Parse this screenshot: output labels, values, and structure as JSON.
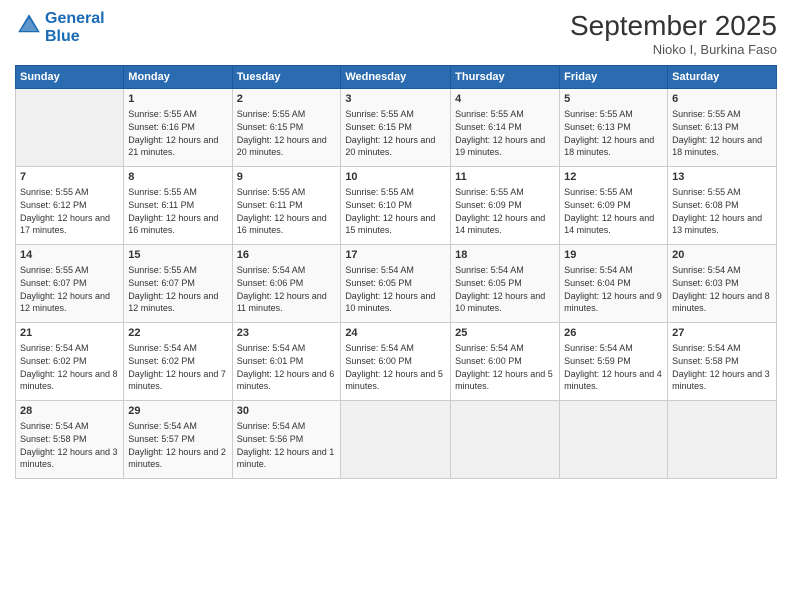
{
  "logo": {
    "line1": "General",
    "line2": "Blue"
  },
  "title": "September 2025",
  "subtitle": "Nioko I, Burkina Faso",
  "header_days": [
    "Sunday",
    "Monday",
    "Tuesday",
    "Wednesday",
    "Thursday",
    "Friday",
    "Saturday"
  ],
  "weeks": [
    [
      {
        "day": "",
        "sunrise": "",
        "sunset": "",
        "daylight": ""
      },
      {
        "day": "1",
        "sunrise": "Sunrise: 5:55 AM",
        "sunset": "Sunset: 6:16 PM",
        "daylight": "Daylight: 12 hours and 21 minutes."
      },
      {
        "day": "2",
        "sunrise": "Sunrise: 5:55 AM",
        "sunset": "Sunset: 6:15 PM",
        "daylight": "Daylight: 12 hours and 20 minutes."
      },
      {
        "day": "3",
        "sunrise": "Sunrise: 5:55 AM",
        "sunset": "Sunset: 6:15 PM",
        "daylight": "Daylight: 12 hours and 20 minutes."
      },
      {
        "day": "4",
        "sunrise": "Sunrise: 5:55 AM",
        "sunset": "Sunset: 6:14 PM",
        "daylight": "Daylight: 12 hours and 19 minutes."
      },
      {
        "day": "5",
        "sunrise": "Sunrise: 5:55 AM",
        "sunset": "Sunset: 6:13 PM",
        "daylight": "Daylight: 12 hours and 18 minutes."
      },
      {
        "day": "6",
        "sunrise": "Sunrise: 5:55 AM",
        "sunset": "Sunset: 6:13 PM",
        "daylight": "Daylight: 12 hours and 18 minutes."
      }
    ],
    [
      {
        "day": "7",
        "sunrise": "Sunrise: 5:55 AM",
        "sunset": "Sunset: 6:12 PM",
        "daylight": "Daylight: 12 hours and 17 minutes."
      },
      {
        "day": "8",
        "sunrise": "Sunrise: 5:55 AM",
        "sunset": "Sunset: 6:11 PM",
        "daylight": "Daylight: 12 hours and 16 minutes."
      },
      {
        "day": "9",
        "sunrise": "Sunrise: 5:55 AM",
        "sunset": "Sunset: 6:11 PM",
        "daylight": "Daylight: 12 hours and 16 minutes."
      },
      {
        "day": "10",
        "sunrise": "Sunrise: 5:55 AM",
        "sunset": "Sunset: 6:10 PM",
        "daylight": "Daylight: 12 hours and 15 minutes."
      },
      {
        "day": "11",
        "sunrise": "Sunrise: 5:55 AM",
        "sunset": "Sunset: 6:09 PM",
        "daylight": "Daylight: 12 hours and 14 minutes."
      },
      {
        "day": "12",
        "sunrise": "Sunrise: 5:55 AM",
        "sunset": "Sunset: 6:09 PM",
        "daylight": "Daylight: 12 hours and 14 minutes."
      },
      {
        "day": "13",
        "sunrise": "Sunrise: 5:55 AM",
        "sunset": "Sunset: 6:08 PM",
        "daylight": "Daylight: 12 hours and 13 minutes."
      }
    ],
    [
      {
        "day": "14",
        "sunrise": "Sunrise: 5:55 AM",
        "sunset": "Sunset: 6:07 PM",
        "daylight": "Daylight: 12 hours and 12 minutes."
      },
      {
        "day": "15",
        "sunrise": "Sunrise: 5:55 AM",
        "sunset": "Sunset: 6:07 PM",
        "daylight": "Daylight: 12 hours and 12 minutes."
      },
      {
        "day": "16",
        "sunrise": "Sunrise: 5:54 AM",
        "sunset": "Sunset: 6:06 PM",
        "daylight": "Daylight: 12 hours and 11 minutes."
      },
      {
        "day": "17",
        "sunrise": "Sunrise: 5:54 AM",
        "sunset": "Sunset: 6:05 PM",
        "daylight": "Daylight: 12 hours and 10 minutes."
      },
      {
        "day": "18",
        "sunrise": "Sunrise: 5:54 AM",
        "sunset": "Sunset: 6:05 PM",
        "daylight": "Daylight: 12 hours and 10 minutes."
      },
      {
        "day": "19",
        "sunrise": "Sunrise: 5:54 AM",
        "sunset": "Sunset: 6:04 PM",
        "daylight": "Daylight: 12 hours and 9 minutes."
      },
      {
        "day": "20",
        "sunrise": "Sunrise: 5:54 AM",
        "sunset": "Sunset: 6:03 PM",
        "daylight": "Daylight: 12 hours and 8 minutes."
      }
    ],
    [
      {
        "day": "21",
        "sunrise": "Sunrise: 5:54 AM",
        "sunset": "Sunset: 6:02 PM",
        "daylight": "Daylight: 12 hours and 8 minutes."
      },
      {
        "day": "22",
        "sunrise": "Sunrise: 5:54 AM",
        "sunset": "Sunset: 6:02 PM",
        "daylight": "Daylight: 12 hours and 7 minutes."
      },
      {
        "day": "23",
        "sunrise": "Sunrise: 5:54 AM",
        "sunset": "Sunset: 6:01 PM",
        "daylight": "Daylight: 12 hours and 6 minutes."
      },
      {
        "day": "24",
        "sunrise": "Sunrise: 5:54 AM",
        "sunset": "Sunset: 6:00 PM",
        "daylight": "Daylight: 12 hours and 5 minutes."
      },
      {
        "day": "25",
        "sunrise": "Sunrise: 5:54 AM",
        "sunset": "Sunset: 6:00 PM",
        "daylight": "Daylight: 12 hours and 5 minutes."
      },
      {
        "day": "26",
        "sunrise": "Sunrise: 5:54 AM",
        "sunset": "Sunset: 5:59 PM",
        "daylight": "Daylight: 12 hours and 4 minutes."
      },
      {
        "day": "27",
        "sunrise": "Sunrise: 5:54 AM",
        "sunset": "Sunset: 5:58 PM",
        "daylight": "Daylight: 12 hours and 3 minutes."
      }
    ],
    [
      {
        "day": "28",
        "sunrise": "Sunrise: 5:54 AM",
        "sunset": "Sunset: 5:58 PM",
        "daylight": "Daylight: 12 hours and 3 minutes."
      },
      {
        "day": "29",
        "sunrise": "Sunrise: 5:54 AM",
        "sunset": "Sunset: 5:57 PM",
        "daylight": "Daylight: 12 hours and 2 minutes."
      },
      {
        "day": "30",
        "sunrise": "Sunrise: 5:54 AM",
        "sunset": "Sunset: 5:56 PM",
        "daylight": "Daylight: 12 hours and 1 minute."
      },
      {
        "day": "",
        "sunrise": "",
        "sunset": "",
        "daylight": ""
      },
      {
        "day": "",
        "sunrise": "",
        "sunset": "",
        "daylight": ""
      },
      {
        "day": "",
        "sunrise": "",
        "sunset": "",
        "daylight": ""
      },
      {
        "day": "",
        "sunrise": "",
        "sunset": "",
        "daylight": ""
      }
    ]
  ]
}
